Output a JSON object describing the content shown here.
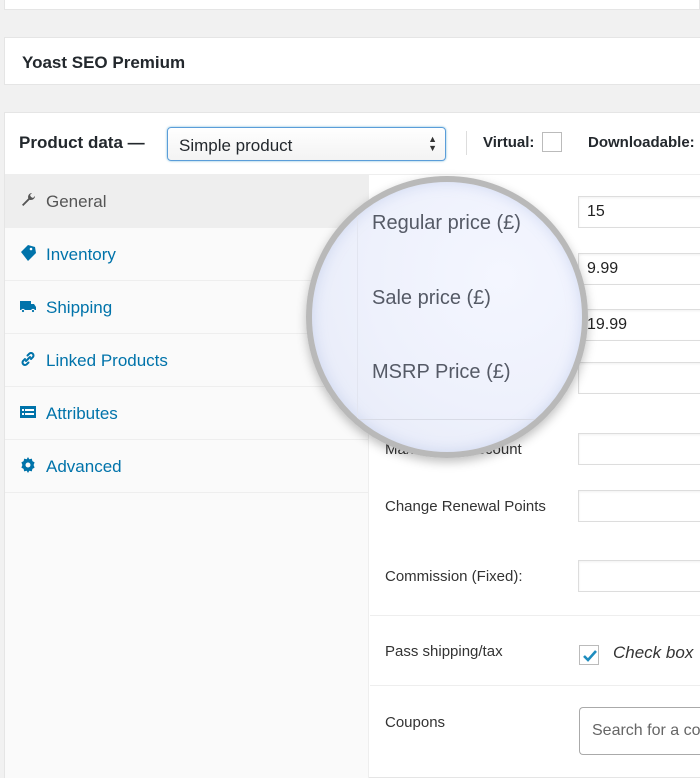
{
  "title_box": {
    "title": "Yoast SEO Premium"
  },
  "product_data": {
    "label": "Product data —",
    "type_select": {
      "value": "Simple product",
      "arrows": "▲▼"
    },
    "virtual_label": "Virtual:",
    "virtual_checked": false,
    "downloadable_label": "Downloadable:"
  },
  "tabs": [
    {
      "label": "General",
      "icon": "wrench-icon",
      "active": true
    },
    {
      "label": "Inventory",
      "icon": "tag-icon",
      "active": false
    },
    {
      "label": "Shipping",
      "icon": "truck-icon",
      "active": false
    },
    {
      "label": "Linked Products",
      "icon": "link-icon",
      "active": false
    },
    {
      "label": "Attributes",
      "icon": "list-icon",
      "active": false
    },
    {
      "label": "Advanced",
      "icon": "gear-icon",
      "active": false
    }
  ],
  "magnifier": {
    "labels": [
      "Regular price (£)",
      "Sale price (£)",
      "MSRP Price (£)"
    ]
  },
  "fields": {
    "regular_price": {
      "value": "15"
    },
    "sale_price": {
      "value": "9.99"
    },
    "msrp_price": {
      "value": "19.99"
    },
    "blank_field": {
      "value": ""
    },
    "max_points_discount": {
      "label": "Max Points Discount",
      "value": ""
    },
    "change_renewal_points": {
      "label": "Change Renewal Points",
      "value": ""
    },
    "commission_fixed": {
      "label": "Commission (Fixed):",
      "value": ""
    },
    "pass_shipping_tax": {
      "label": "Pass shipping/tax",
      "checked": true,
      "description": "Check box"
    },
    "coupons": {
      "label": "Coupons",
      "placeholder": "Search for a coupon…"
    }
  },
  "colors": {
    "link": "#0073aa",
    "focus": "#5b9dd9",
    "check": "#1e8cbe"
  }
}
